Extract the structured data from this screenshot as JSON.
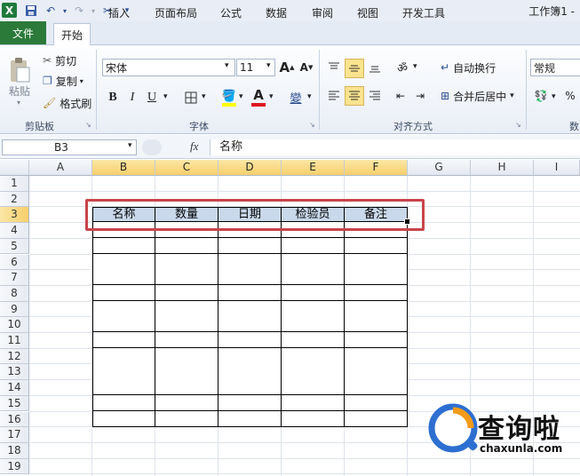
{
  "titlebar": {
    "title": "工作簿1 -"
  },
  "tabs": [
    "文件",
    "开始",
    "插入",
    "页面布局",
    "公式",
    "数据",
    "审阅",
    "视图",
    "开发工具"
  ],
  "clipboard": {
    "paste": "粘贴",
    "cut": "剪切",
    "copy": "复制",
    "format_painter": "格式刷",
    "group": "剪贴板"
  },
  "font": {
    "name": "宋体",
    "size": "11",
    "grow": "A",
    "shrink": "A",
    "group": "字体",
    "bold": "B",
    "italic": "I",
    "underline": "U",
    "font_color_glyph": "A",
    "wen": "變"
  },
  "alignment": {
    "wrap": "自动换行",
    "merge": "合并后居中",
    "group": "对齐方式"
  },
  "number": {
    "format": "常规",
    "percent": "%",
    "group": "数"
  },
  "formula_bar": {
    "cell_ref": "B3",
    "fx": "fx",
    "value": "名称"
  },
  "columns": [
    "A",
    "B",
    "C",
    "D",
    "E",
    "F",
    "G",
    "H",
    "I"
  ],
  "rows": [
    "1",
    "2",
    "3",
    "4",
    "5",
    "6",
    "7",
    "8",
    "9",
    "10",
    "11",
    "12",
    "13",
    "14",
    "15",
    "16",
    "17",
    "18",
    "19"
  ],
  "table": {
    "headers": [
      "名称",
      "数量",
      "日期",
      "检验员",
      "备注"
    ]
  },
  "watermark": {
    "brand": "查询啦",
    "domain": "chaxunla.com"
  },
  "colors": {
    "file_tab": "#2b7a3a",
    "selected_header": "#f6cf6b",
    "table_header_fill": "#c9d8ea",
    "highlight_box": "#c8454a"
  }
}
